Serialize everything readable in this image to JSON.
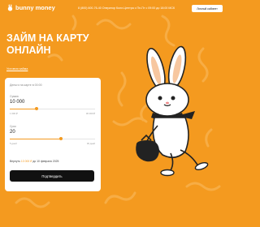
{
  "header": {
    "brand": "bunny money",
    "info": "8 (800) 600-76-40 Оператор Колл-Центра с Пн-Пт с 09:00 до 18:00 МСК",
    "cabinet_label": "Личный кабинет"
  },
  "hero": {
    "title": "ЗАЙМ НА КАРТУ ОНЛАЙН",
    "conditions_link": "Условия займа"
  },
  "calculator": {
    "deadline_label": "Деньги на карте в 00:00",
    "amount": {
      "label": "Сумма",
      "value": "10 000",
      "min": "1 000 ₽",
      "max": "30 000 ₽",
      "level": 0.31
    },
    "term": {
      "label": "Срок",
      "value": "20",
      "min": "5 дней",
      "max": "30 дней",
      "level": 0.6
    },
    "formula_prefix": "Вернуть",
    "formula_amount": "13 000 ₽",
    "formula_suffix": "до 10 февраля 2025",
    "confirm_label": "Подтвердить"
  },
  "colors": {
    "accent": "#f49a1f",
    "button": "#111111",
    "card": "#ffffff"
  },
  "icons": {
    "logo": "bunny-logo-icon",
    "illustration": "bunny-with-money-bag-illustration"
  }
}
